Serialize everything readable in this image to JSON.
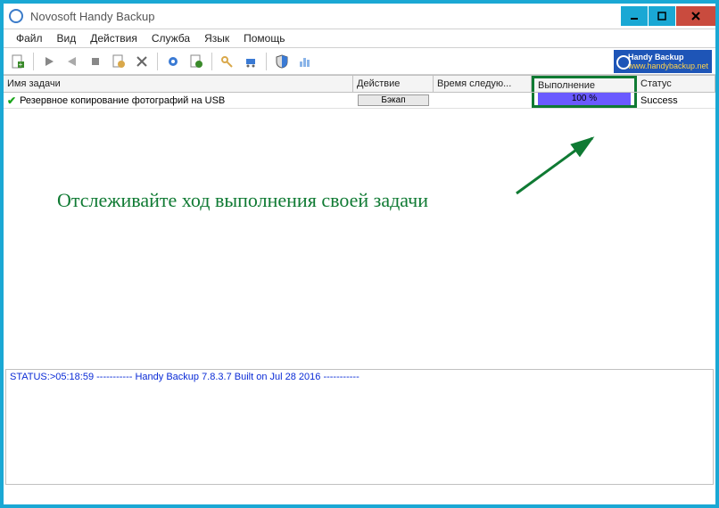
{
  "window": {
    "title": "Novosoft Handy Backup"
  },
  "menu": {
    "file": "Файл",
    "view": "Вид",
    "actions": "Действия",
    "service": "Служба",
    "language": "Язык",
    "help": "Помощь"
  },
  "logo": {
    "title": "Handy Backup",
    "url": "www.handybackup.net"
  },
  "columns": {
    "name": "Имя задачи",
    "action": "Действие",
    "next": "Время следую...",
    "progress": "Выполнение",
    "status": "Статус"
  },
  "row": {
    "name": "Резервное копирование фотографий на USB",
    "action": "Бэкап",
    "next": "",
    "progress": "100 %",
    "status": "Success"
  },
  "annotation": "Отслеживайте ход выполнения своей задачи",
  "log": {
    "line1": "STATUS:>05:18:59 ----------- Handy Backup 7.8.3.7 Built on Jul 28 2016 -----------"
  },
  "colors": {
    "accent": "#1aa8d4",
    "highlight": "#0f7a33",
    "progress": "#6a5aff"
  }
}
